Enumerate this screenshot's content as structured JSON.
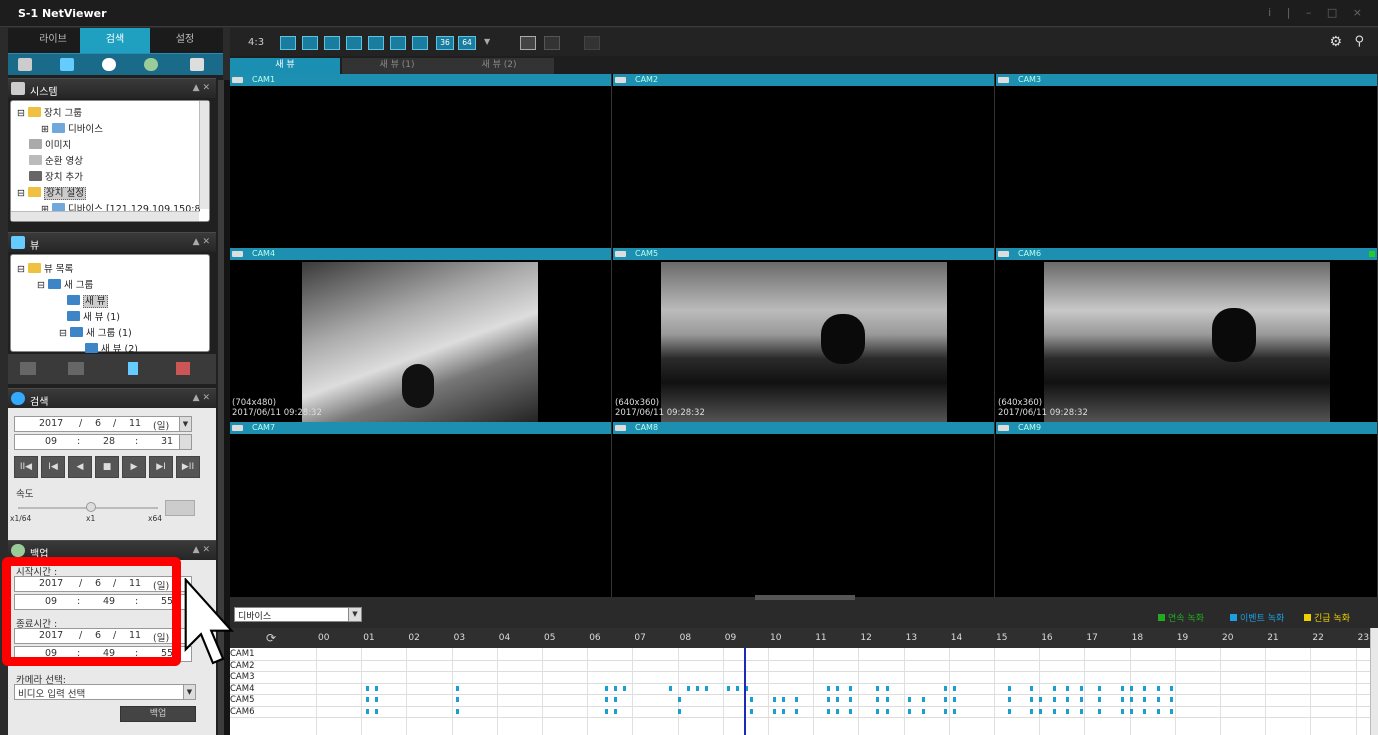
{
  "app": {
    "title": "S-1 NetViewer",
    "window_controls": "i | – □ ×"
  },
  "main_tabs": [
    {
      "label": "라이브"
    },
    {
      "label": "검색"
    },
    {
      "label": "설정"
    }
  ],
  "system_panel": {
    "title": "시스템",
    "tree": [
      {
        "label": "장치 그룹"
      },
      {
        "label": "디바이스"
      },
      {
        "label": "이미지"
      },
      {
        "label": "순환 영상"
      },
      {
        "label": "장치 추가"
      },
      {
        "label": "장치 설정"
      },
      {
        "label": "디바이스 [121.129.109.150:8"
      }
    ]
  },
  "view_panel": {
    "title": "뷰",
    "tree": [
      {
        "label": "뷰 목록"
      },
      {
        "label": "새 그룹"
      },
      {
        "label": "새 뷰"
      },
      {
        "label": "새 뷰 (1)"
      },
      {
        "label": "새 그룹 (1)"
      },
      {
        "label": "새 뷰 (2)"
      }
    ]
  },
  "search_panel": {
    "title": "검색",
    "date": {
      "year": "2017",
      "month": "6",
      "day": "11",
      "weekday": "(일)"
    },
    "time": {
      "h": "09",
      "m": "28",
      "s": "31"
    },
    "speed_label": "속도",
    "speed_marks": {
      "min": "x1/64",
      "mid": "x1",
      "max": "x64"
    },
    "playback_buttons": [
      "II◀",
      "I◀",
      "◀",
      "■",
      "▶",
      "▶I",
      "▶II"
    ]
  },
  "backup_panel": {
    "title": "백업",
    "start_label": "시작시간 :",
    "start_date": {
      "year": "2017",
      "month": "6",
      "day": "11",
      "weekday": "(일)"
    },
    "start_time": {
      "h": "09",
      "m": "49",
      "s": "55"
    },
    "end_label": "종료시간 :",
    "end_date": {
      "year": "2017",
      "month": "6",
      "day": "11",
      "weekday": "(일)"
    },
    "end_time": {
      "h": "09",
      "m": "49",
      "s": "55"
    },
    "camera_label": "카메라 선택:",
    "camera_select": "비디오 입력 선택",
    "backup_button": "백업"
  },
  "toolbar": {
    "aspect": "4:3",
    "layout_36": "36",
    "layout_64": "64"
  },
  "view_tabs": [
    {
      "label": "새 뷰"
    },
    {
      "label": "새 뷰 (1)"
    },
    {
      "label": "새 뷰 (2)"
    }
  ],
  "cameras": [
    {
      "name": "CAM1",
      "res": "",
      "ts": ""
    },
    {
      "name": "CAM2",
      "res": "",
      "ts": ""
    },
    {
      "name": "CAM3",
      "res": "",
      "ts": ""
    },
    {
      "name": "CAM4",
      "res": "(704x480)",
      "ts": "2017/06/11 09:28:32"
    },
    {
      "name": "CAM5",
      "res": "(640x360)",
      "ts": "2017/06/11 09:28:32"
    },
    {
      "name": "CAM6",
      "res": "(640x360)",
      "ts": "2017/06/11 09:28:32"
    },
    {
      "name": "CAM7",
      "res": "",
      "ts": ""
    },
    {
      "name": "CAM8",
      "res": "",
      "ts": ""
    },
    {
      "name": "CAM9",
      "res": "",
      "ts": ""
    }
  ],
  "timeline": {
    "device_select": "디바이스",
    "legend": [
      {
        "label": "연속 녹화",
        "color": "#22aa22"
      },
      {
        "label": "이벤트 녹화",
        "color": "#1aa0e0"
      },
      {
        "label": "긴급 녹화",
        "color": "#f0d000"
      }
    ],
    "hours": [
      "00",
      "01",
      "02",
      "03",
      "04",
      "05",
      "06",
      "07",
      "08",
      "09",
      "10",
      "11",
      "12",
      "13",
      "14",
      "15",
      "16",
      "17",
      "18",
      "19",
      "20",
      "21",
      "22",
      "23"
    ],
    "rows": [
      "CAM1",
      "CAM2",
      "CAM3",
      "CAM4",
      "CAM5",
      "CAM6"
    ],
    "cursor_hour": 9.48
  }
}
